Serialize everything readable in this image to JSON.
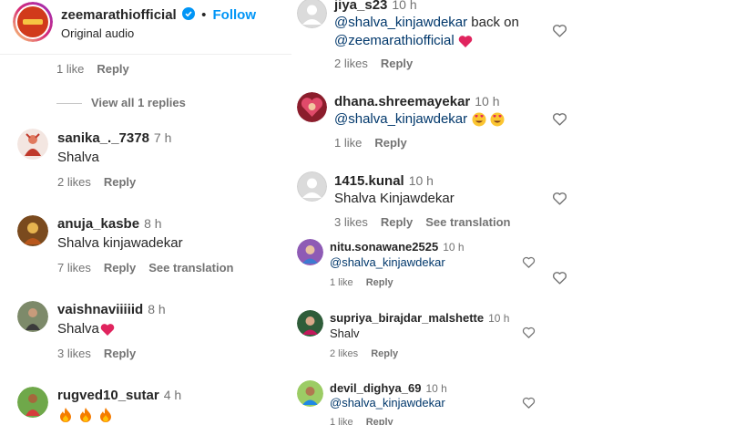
{
  "post": {
    "username": "zeemarathiofficial",
    "follow_label": "Follow",
    "audio_label": "Original audio",
    "separator": "•",
    "likes": "1 like",
    "reply": "Reply",
    "view_replies": "View all 1 replies"
  },
  "left_comments": [
    {
      "username": "sanika_._7378",
      "time": "7 h",
      "text": "Shalva",
      "likes": "2 likes",
      "reply": "Reply"
    },
    {
      "username": "anuja_kasbe",
      "time": "8 h",
      "text": "Shalva kinjawadekar",
      "likes": "7 likes",
      "reply": "Reply",
      "translate": "See translation"
    },
    {
      "username": "vaishnaviiiiid",
      "time": "8 h",
      "text": "Shalva",
      "likes": "3 likes",
      "reply": "Reply"
    },
    {
      "username": "rugved10_sutar",
      "time": "4 h"
    }
  ],
  "right_comments": [
    {
      "username": "jiya_s23",
      "time": "10 h",
      "line1": "@shalva_kinjawdekar",
      "line1_rest": " back on",
      "line2": "@zeemarathiofficial",
      "likes": "2 likes",
      "reply": "Reply"
    },
    {
      "username": "dhana.shreemayekar",
      "time": "10 h",
      "text": "@shalva_kinjawdekar",
      "likes": "1 like",
      "reply": "Reply"
    },
    {
      "username": "1415.kunal",
      "time": "10 h",
      "text": "Shalva Kinjawdekar",
      "likes": "3 likes",
      "reply": "Reply",
      "translate": "See translation"
    },
    {
      "username": "nitu.sonawane2525",
      "time": "10 h",
      "text": "@shalva_kinjawdekar",
      "likes": "1 like",
      "reply": "Reply"
    },
    {
      "username": "supriya_birajdar_malshette",
      "time": "10 h",
      "text": "Shalv",
      "likes": "2 likes",
      "reply": "Reply"
    },
    {
      "username": "devil_dighya_69",
      "time": "10 h",
      "text": "@shalva_kinjawdekar",
      "likes": "1 like",
      "reply": "Reply"
    }
  ],
  "colors": {
    "link": "#00376b",
    "follow": "#0095f6",
    "muted": "#737373",
    "verified": "#0095f6"
  }
}
